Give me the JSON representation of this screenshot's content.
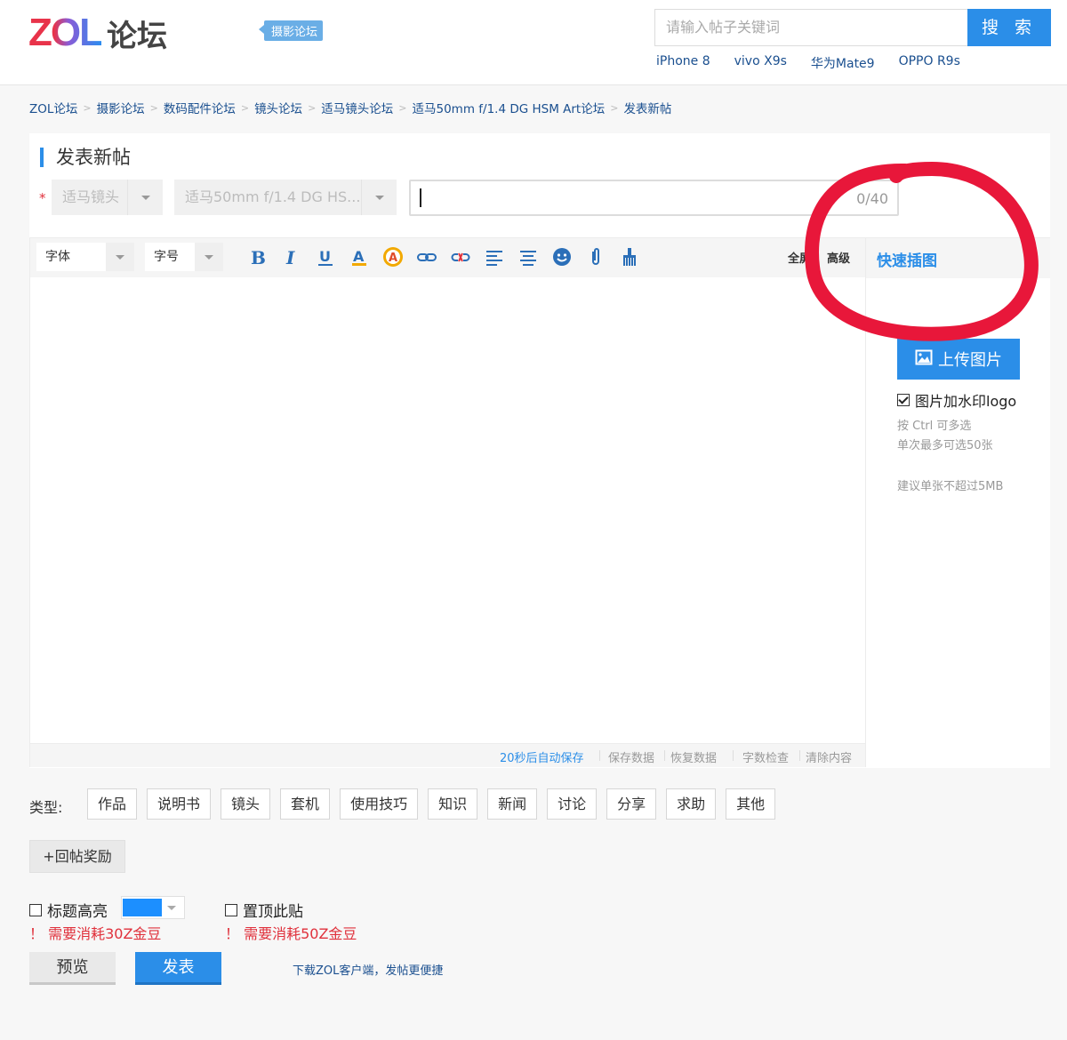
{
  "header": {
    "logo_zol": "ZOL",
    "logo_forum": "论坛",
    "forum_tag": "摄影论坛",
    "search_placeholder": "请输入帖子关键词",
    "search_button": "搜 索",
    "hotwords": [
      "iPhone 8",
      "vivo X9s",
      "华为Mate9",
      "OPPO R9s"
    ]
  },
  "breadcrumb": [
    "ZOL论坛",
    "摄影论坛",
    "数码配件论坛",
    "镜头论坛",
    "适马镜头论坛",
    "适马50mm f/1.4 DG HSM Art论坛",
    "发表新帖"
  ],
  "form": {
    "title": "发表新帖",
    "required_mark": "*",
    "select_brand": "适马镜头",
    "select_product": "适马50mm f/1.4 DG HS...",
    "title_counter": "0/40"
  },
  "toolbar": {
    "font_label": "字体",
    "size_label": "字号",
    "icons": [
      "bold-icon",
      "italic-icon",
      "underline-icon",
      "font-color-icon",
      "highlight-icon",
      "link-icon",
      "unlink-icon",
      "align-left-icon",
      "align-center-icon",
      "emoji-icon",
      "attachment-icon",
      "clean-format-icon"
    ],
    "fullscreen": "全屏",
    "advanced": "高级"
  },
  "editor_footer": {
    "autosave": "20秒后自动保存",
    "save": "保存数据",
    "restore": "恢复数据",
    "wordcheck": "字数检查",
    "clear": "清除内容"
  },
  "side": {
    "title": "快速插图",
    "upload": "上传图片",
    "watermark": "图片加水印logo",
    "watermark_checked": true,
    "hint1": "按 Ctrl 可多选",
    "hint2": "单次最多可选50张",
    "hint3": "建议单张不超过5MB",
    "annotation_color": "#e8173a"
  },
  "types": {
    "label": "类型:",
    "items": [
      "作品",
      "说明书",
      "镜头",
      "套机",
      "使用技巧",
      "知识",
      "新闻",
      "讨论",
      "分享",
      "求助",
      "其他"
    ]
  },
  "reward_button": "+回帖奖励",
  "options": {
    "highlight_label": "标题高亮",
    "highlight_color": "#1c8fff",
    "highlight_cost": "！ 需要消耗30Z金豆",
    "sticky_label": "置顶此贴",
    "sticky_cost": "！ 需要消耗50Z金豆"
  },
  "actions": {
    "preview": "预览",
    "publish": "发表",
    "client_link": "下载ZOL客户端，发帖更便捷"
  }
}
